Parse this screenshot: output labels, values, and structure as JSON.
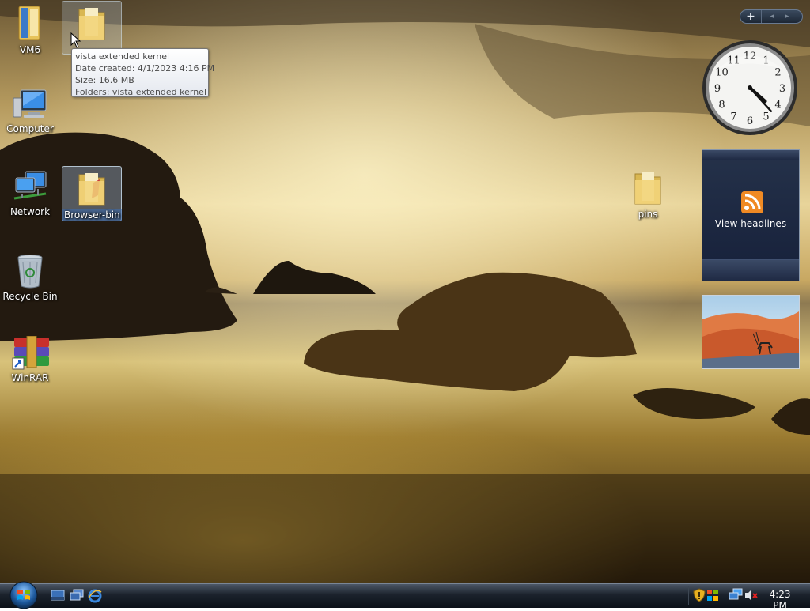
{
  "desktop": {
    "icons": [
      {
        "label": "VM6"
      },
      {
        "label": "Computer"
      },
      {
        "label": "Network"
      },
      {
        "label": "Recycle Bin"
      },
      {
        "label": "WinRAR"
      },
      {
        "label": "Browser-bin"
      },
      {
        "label": "pins"
      }
    ]
  },
  "tooltip": {
    "line1": "vista extended kernel",
    "line2": "Date created: 4/1/2023 4:16 PM",
    "line3": "Size: 16.6 MB",
    "line4": "Folders: vista extended kernel"
  },
  "sidebar": {
    "add_label": "+",
    "nav_label": "◂ ▸",
    "clock_time": {
      "hour": 4,
      "minute": 23
    },
    "feed_label": "View headlines"
  },
  "taskbar": {
    "clock": "4:23 PM"
  },
  "colors": {
    "accent": "#f08a24",
    "taskbar": "#1b222c",
    "folder": "#f2d47a"
  }
}
